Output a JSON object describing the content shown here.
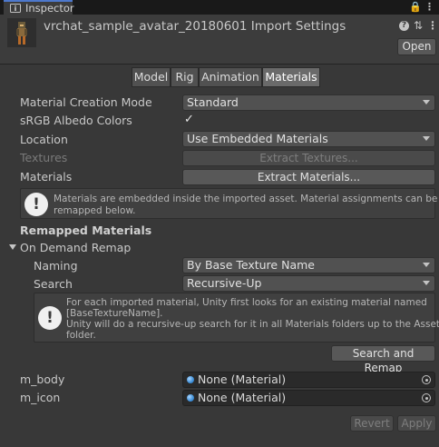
{
  "window": {
    "tab_label": "Inspector",
    "lock_glyph": "🔒",
    "menu_glyph": "⋮"
  },
  "header": {
    "title": "vrchat_sample_avatar_20180601 Import Settings",
    "open_label": "Open",
    "help_glyph": "?",
    "preset_glyph": "⇅",
    "overflow_glyph": "⋮"
  },
  "tabs": [
    {
      "label": "Model"
    },
    {
      "label": "Rig"
    },
    {
      "label": "Animation"
    },
    {
      "label": "Materials"
    }
  ],
  "active_tab": "Materials",
  "fields": {
    "material_creation_mode": {
      "label": "Material Creation Mode",
      "value": "Standard"
    },
    "srgb_albedo": {
      "label": "sRGB Albedo Colors",
      "checked": true,
      "check_glyph": "✓"
    },
    "location": {
      "label": "Location",
      "value": "Use Embedded Materials"
    },
    "textures": {
      "label": "Textures",
      "button": "Extract Textures..."
    },
    "materials": {
      "label": "Materials",
      "button": "Extract Materials..."
    }
  },
  "help1": {
    "icon_glyph": "!",
    "line1": "Materials are embedded inside the imported asset. Material assignments can be",
    "line2": "remapped below."
  },
  "remapped": {
    "section_title": "Remapped Materials",
    "foldout_label": "On Demand Remap",
    "naming": {
      "label": "Naming",
      "value": "By Base Texture Name"
    },
    "search": {
      "label": "Search",
      "value": "Recursive-Up"
    },
    "help": {
      "icon_glyph": "!",
      "line1": "For each imported material, Unity first looks for an existing material named",
      "line2": "[BaseTextureName].",
      "line3": "Unity will do a recursive-up search for it in all Materials folders up to the Assets",
      "line4": "folder."
    },
    "search_remap_button": "Search and Remap"
  },
  "material_slots": [
    {
      "name": "m_body",
      "value": "None (Material)"
    },
    {
      "name": "m_icon",
      "value": "None (Material)"
    }
  ],
  "footer": {
    "revert_label": "Revert",
    "apply_label": "Apply"
  }
}
